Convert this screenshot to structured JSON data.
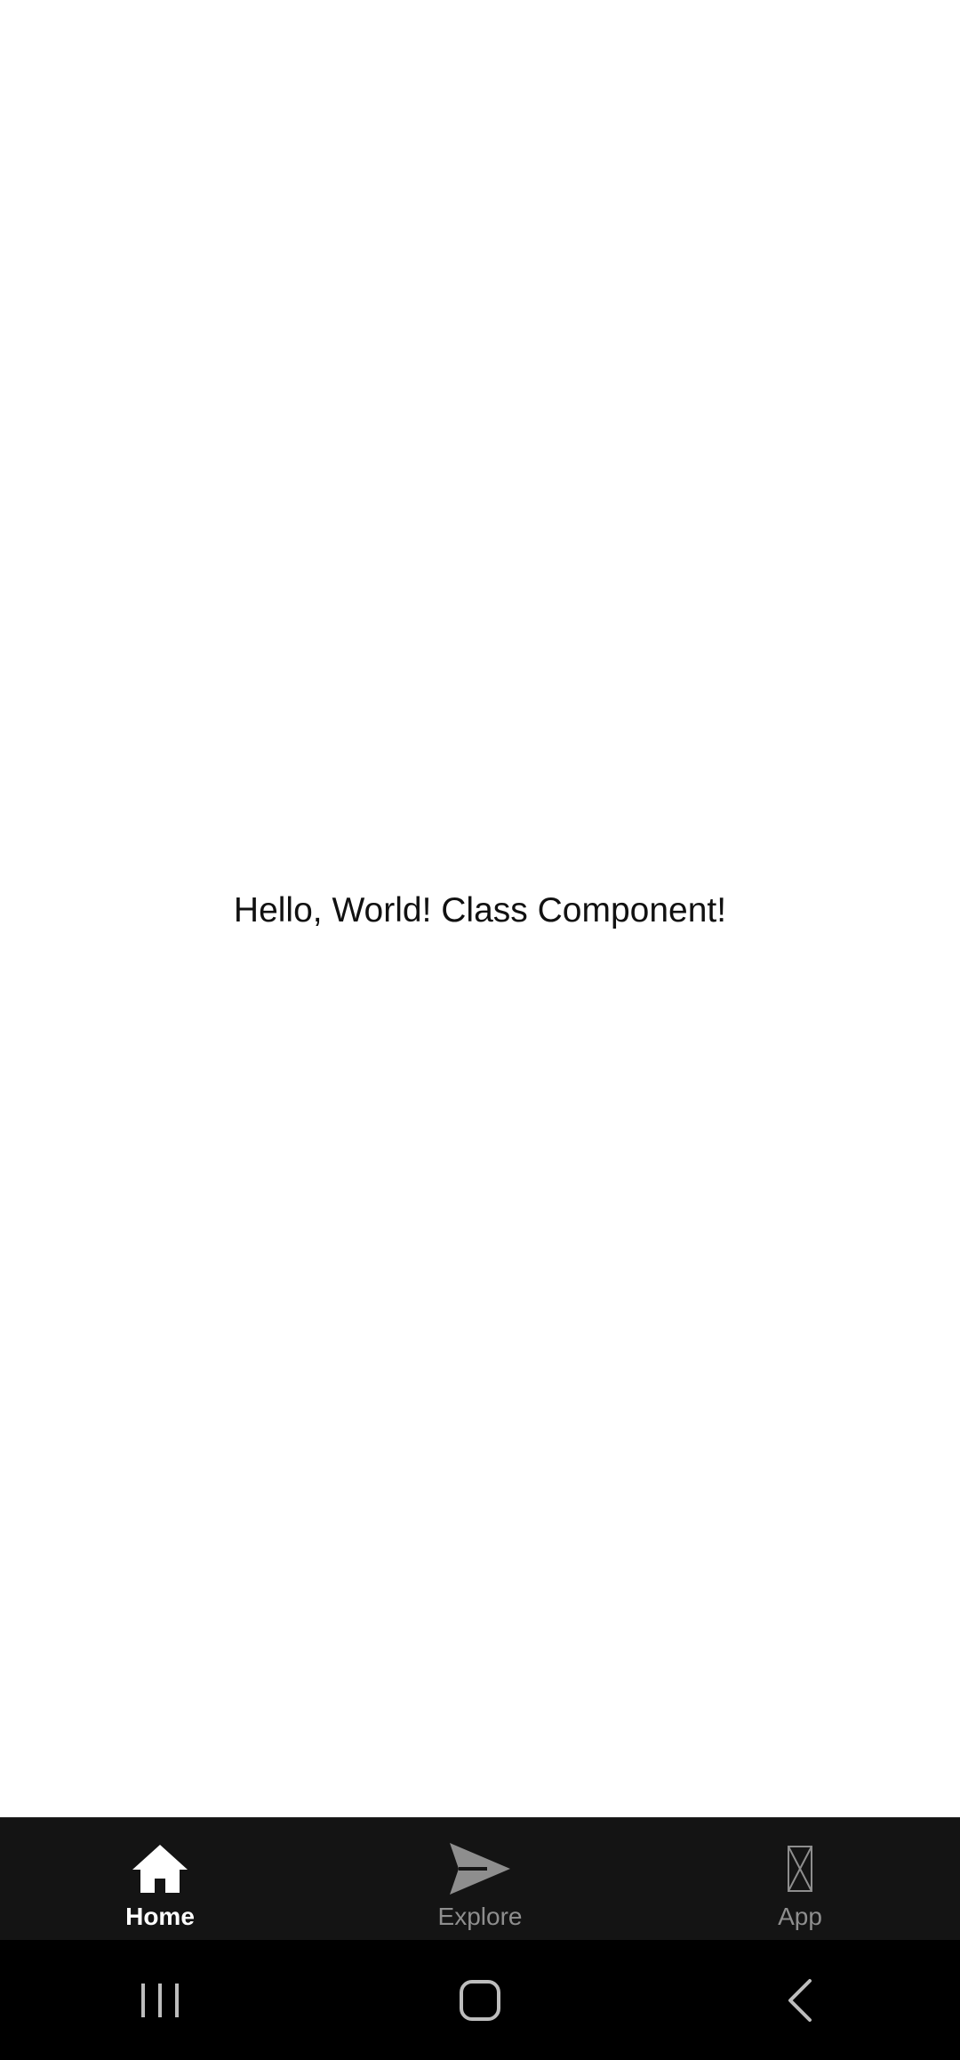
{
  "content": {
    "message": "Hello, World! Class Component!"
  },
  "tab_bar": {
    "background": "#141414",
    "active_color": "#ffffff",
    "inactive_color": "#8e8e8e",
    "tabs": [
      {
        "label": "Home",
        "icon": "home-icon",
        "active": true
      },
      {
        "label": "Explore",
        "icon": "send-icon",
        "active": false
      },
      {
        "label": "App",
        "icon": "missing-glyph-icon",
        "active": false
      }
    ]
  },
  "system_nav": {
    "buttons": [
      {
        "icon": "recents-icon"
      },
      {
        "icon": "home-button-icon"
      },
      {
        "icon": "back-icon"
      }
    ]
  }
}
